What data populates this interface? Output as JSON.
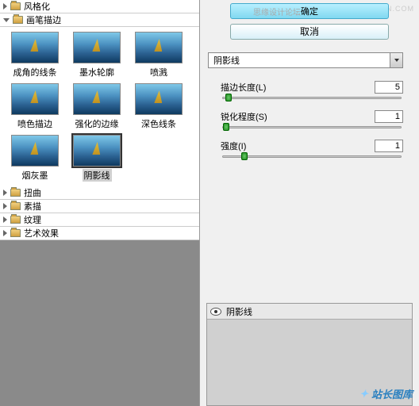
{
  "watermark": "WWW.MISSYUAN.COM",
  "categories": {
    "stylize": "风格化",
    "brush": "画笔描边",
    "distort": "扭曲",
    "sketch": "素描",
    "texture": "纹理",
    "artistic": "艺术效果"
  },
  "thumbs": [
    {
      "label": "成角的线条"
    },
    {
      "label": "墨水轮廓"
    },
    {
      "label": "喷溅"
    },
    {
      "label": "喷色描边"
    },
    {
      "label": "强化的边缘"
    },
    {
      "label": "深色线条"
    },
    {
      "label": "烟灰墨"
    },
    {
      "label": "阴影线",
      "selected": true
    }
  ],
  "buttons": {
    "ok": "确定",
    "cancel": "取消"
  },
  "subtitle": "思缘设计论坛",
  "filter_select": "阴影线",
  "sliders": [
    {
      "label": "描边长度(L)",
      "value": "5",
      "pos": 3
    },
    {
      "label": "锐化程度(S)",
      "value": "1",
      "pos": 2
    },
    {
      "label": "强度(I)",
      "value": "1",
      "pos": 12
    }
  ],
  "preview_label": "阴影线",
  "footer": "站长图库"
}
